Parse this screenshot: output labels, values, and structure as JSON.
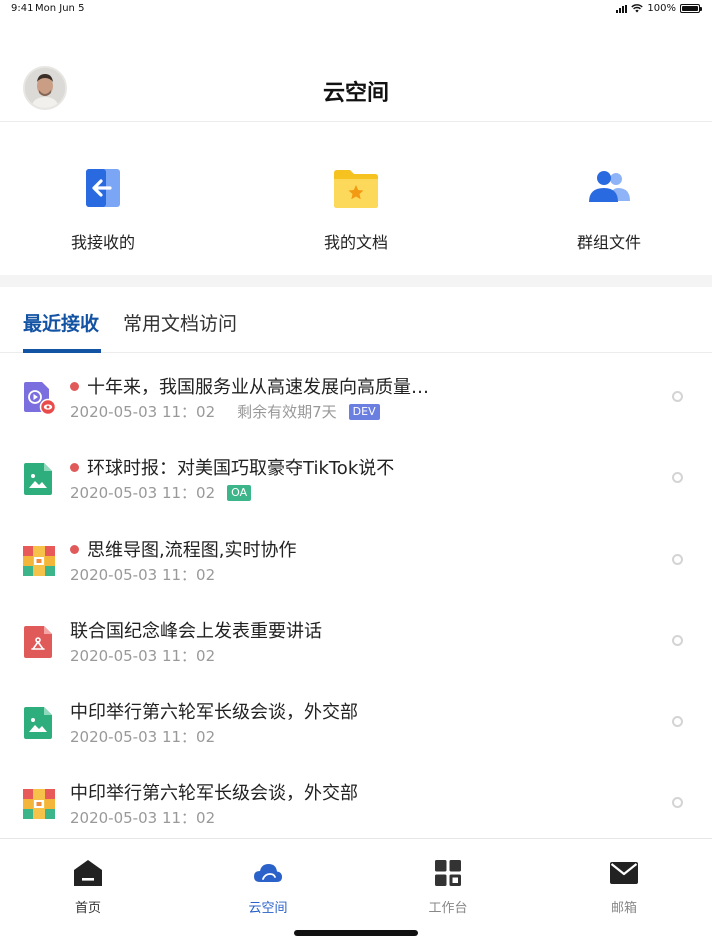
{
  "status_bar": {
    "time": "9:41",
    "date": "Mon Jun 5",
    "battery": "100%"
  },
  "header": {
    "title": "云空间"
  },
  "quick_actions": [
    {
      "label": "我接收的",
      "icon": "received-icon"
    },
    {
      "label": "我的文档",
      "icon": "folder-star-icon"
    },
    {
      "label": "群组文件",
      "icon": "group-icon"
    }
  ],
  "tabs": [
    {
      "label": "最近接收",
      "active": true
    },
    {
      "label": "常用文档访问",
      "active": false
    }
  ],
  "files": [
    {
      "title": "十年来，我国服务业从高速发展向高质量…",
      "unread": true,
      "date": "2020-05-03 11：02",
      "expiry": "剩余有效期7天",
      "tag": "DEV",
      "icon": "video-file-icon"
    },
    {
      "title": "环球时报：对美国巧取豪夺TikTok说不",
      "unread": true,
      "date": "2020-05-03 11：02",
      "tag": "OA",
      "icon": "image-file-icon"
    },
    {
      "title": "思维导图,流程图,实时协作",
      "unread": true,
      "date": "2020-05-03 11：02",
      "icon": "archive-file-icon"
    },
    {
      "title": "联合国纪念峰会上发表重要讲话",
      "unread": false,
      "date": "2020-05-03 11：02",
      "icon": "pdf-file-icon"
    },
    {
      "title": "中印举行第六轮军长级会谈，外交部",
      "unread": false,
      "date": "2020-05-03 11：02",
      "icon": "image-file-icon"
    },
    {
      "title": "中印举行第六轮军长级会谈，外交部",
      "unread": false,
      "date": "2020-05-03 11：02",
      "icon": "archive-file-icon"
    }
  ],
  "tabbar": [
    {
      "label": "首页",
      "icon": "home-icon"
    },
    {
      "label": "云空间",
      "icon": "cloud-icon",
      "active": true
    },
    {
      "label": "工作台",
      "icon": "apps-icon"
    },
    {
      "label": "邮箱",
      "icon": "mail-icon"
    }
  ],
  "colors": {
    "accent": "#1353a4",
    "unread_dot": "#e05a5a",
    "tag_dev": "#6b7fe0",
    "tag_oa": "#3db58a"
  }
}
